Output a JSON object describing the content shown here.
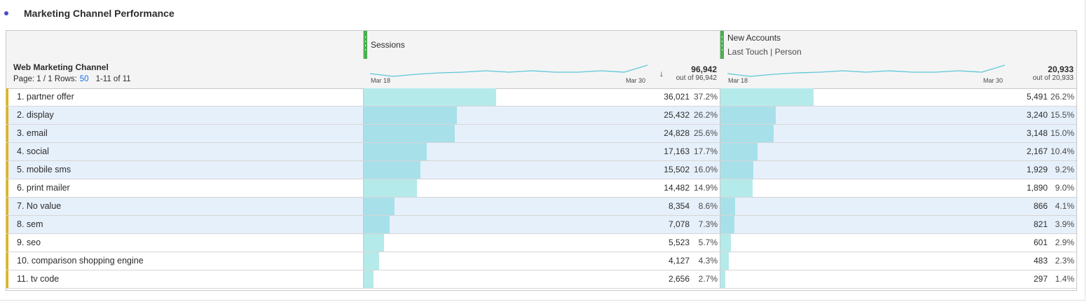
{
  "panel": {
    "title": "Marketing Channel Performance"
  },
  "table": {
    "dimension_title": "Web Marketing Channel",
    "pager": {
      "page_text": "Page: 1 / 1 Rows:",
      "rows_value": "50",
      "range": "1-11 of 11"
    },
    "columns": [
      {
        "name": "Sessions",
        "subtitle": "",
        "total": "96,942",
        "out_of": "out of 96,942",
        "spark_start": "Mar 18",
        "spark_end": "Mar 30",
        "sorted": "descending"
      },
      {
        "name": "New Accounts",
        "subtitle": "Last Touch | Person",
        "total": "20,933",
        "out_of": "out of 20,933",
        "spark_start": "Mar 18",
        "spark_end": "Mar 30",
        "sorted": ""
      }
    ],
    "rows": [
      {
        "label": "1. partner offer",
        "sessions": "36,021",
        "sessions_pct": "37.2%",
        "sessions_frac": 0.372,
        "accounts": "5,491",
        "accounts_pct": "26.2%",
        "accounts_frac": 0.262,
        "highlighted": false
      },
      {
        "label": "2. display",
        "sessions": "25,432",
        "sessions_pct": "26.2%",
        "sessions_frac": 0.262,
        "accounts": "3,240",
        "accounts_pct": "15.5%",
        "accounts_frac": 0.155,
        "highlighted": true
      },
      {
        "label": "3. email",
        "sessions": "24,828",
        "sessions_pct": "25.6%",
        "sessions_frac": 0.256,
        "accounts": "3,148",
        "accounts_pct": "15.0%",
        "accounts_frac": 0.15,
        "highlighted": true
      },
      {
        "label": "4. social",
        "sessions": "17,163",
        "sessions_pct": "17.7%",
        "sessions_frac": 0.177,
        "accounts": "2,167",
        "accounts_pct": "10.4%",
        "accounts_frac": 0.104,
        "highlighted": true
      },
      {
        "label": "5. mobile sms",
        "sessions": "15,502",
        "sessions_pct": "16.0%",
        "sessions_frac": 0.16,
        "accounts": "1,929",
        "accounts_pct": "9.2%",
        "accounts_frac": 0.092,
        "highlighted": true
      },
      {
        "label": "6. print mailer",
        "sessions": "14,482",
        "sessions_pct": "14.9%",
        "sessions_frac": 0.149,
        "accounts": "1,890",
        "accounts_pct": "9.0%",
        "accounts_frac": 0.09,
        "highlighted": false
      },
      {
        "label": "7. No value",
        "sessions": "8,354",
        "sessions_pct": "8.6%",
        "sessions_frac": 0.086,
        "accounts": "866",
        "accounts_pct": "4.1%",
        "accounts_frac": 0.041,
        "highlighted": true
      },
      {
        "label": "8. sem",
        "sessions": "7,078",
        "sessions_pct": "7.3%",
        "sessions_frac": 0.073,
        "accounts": "821",
        "accounts_pct": "3.9%",
        "accounts_frac": 0.039,
        "highlighted": true
      },
      {
        "label": "9. seo",
        "sessions": "5,523",
        "sessions_pct": "5.7%",
        "sessions_frac": 0.057,
        "accounts": "601",
        "accounts_pct": "2.9%",
        "accounts_frac": 0.029,
        "highlighted": false
      },
      {
        "label": "10. comparison shopping engine",
        "sessions": "4,127",
        "sessions_pct": "4.3%",
        "sessions_frac": 0.043,
        "accounts": "483",
        "accounts_pct": "2.3%",
        "accounts_frac": 0.023,
        "highlighted": false
      },
      {
        "label": "11. tv code",
        "sessions": "2,656",
        "sessions_pct": "2.7%",
        "sessions_frac": 0.027,
        "accounts": "297",
        "accounts_pct": "1.4%",
        "accounts_frac": 0.014,
        "highlighted": false
      }
    ]
  },
  "colors": {
    "accent_handle": "#4caf50",
    "row_marker": "#e4b200",
    "bar": "#b5eaea",
    "bar_highlight": "#a8e0ea",
    "row_highlight": "#e6f0fb",
    "link": "#1473e6",
    "title_dot": "#4b4bd1"
  }
}
